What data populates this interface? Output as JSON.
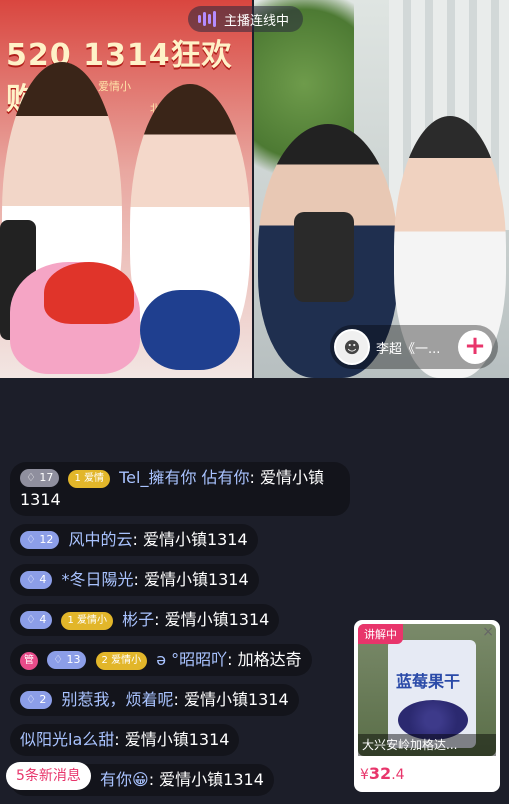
{
  "live_status": "主播连线中",
  "banner": {
    "title": "520 1314狂欢购",
    "subline1": "爱情小",
    "subline2": "北"
  },
  "guest": {
    "name": "李超《一...",
    "follow_symbol": "+"
  },
  "chat": [
    {
      "level": "17",
      "fan_level": "1",
      "fan_club": "爱情",
      "user": "Tel_擁有你 佔有你",
      "text": ": 爱情小镇1314"
    },
    {
      "level": "12",
      "user": "风中的云",
      "text": ": 爱情小镇1314"
    },
    {
      "level": "4",
      "user": "*冬日陽光",
      "text": ": 爱情小镇1314"
    },
    {
      "level": "4",
      "fan_level": "1",
      "fan_club": "爱情小",
      "user": "彬子",
      "text": ": 爱情小镇1314"
    },
    {
      "manager": "管",
      "level": "13",
      "fan_level": "2",
      "fan_club": "爱情小",
      "user": "ə °昭昭吖",
      "text": ": 加格达奇"
    },
    {
      "level": "2",
      "user": "别惹我，烦着呢",
      "text": ": 爱情小镇1314"
    },
    {
      "user": "似阳光la么甜",
      "text": ": 爱情小镇1314"
    },
    {
      "user": "有你😀",
      "text": ": 爱情小镇1314"
    }
  ],
  "new_messages": "5条新消息",
  "product": {
    "badge": "讲解中",
    "close": "×",
    "bag_title": "蓝莓果干",
    "caption": "大兴安岭加格达...",
    "price_symbol": "¥",
    "price_int": "32",
    "price_dec": ".4"
  },
  "colors": {
    "accent": "#e8356b",
    "chat_bg": "#1c1e29"
  }
}
